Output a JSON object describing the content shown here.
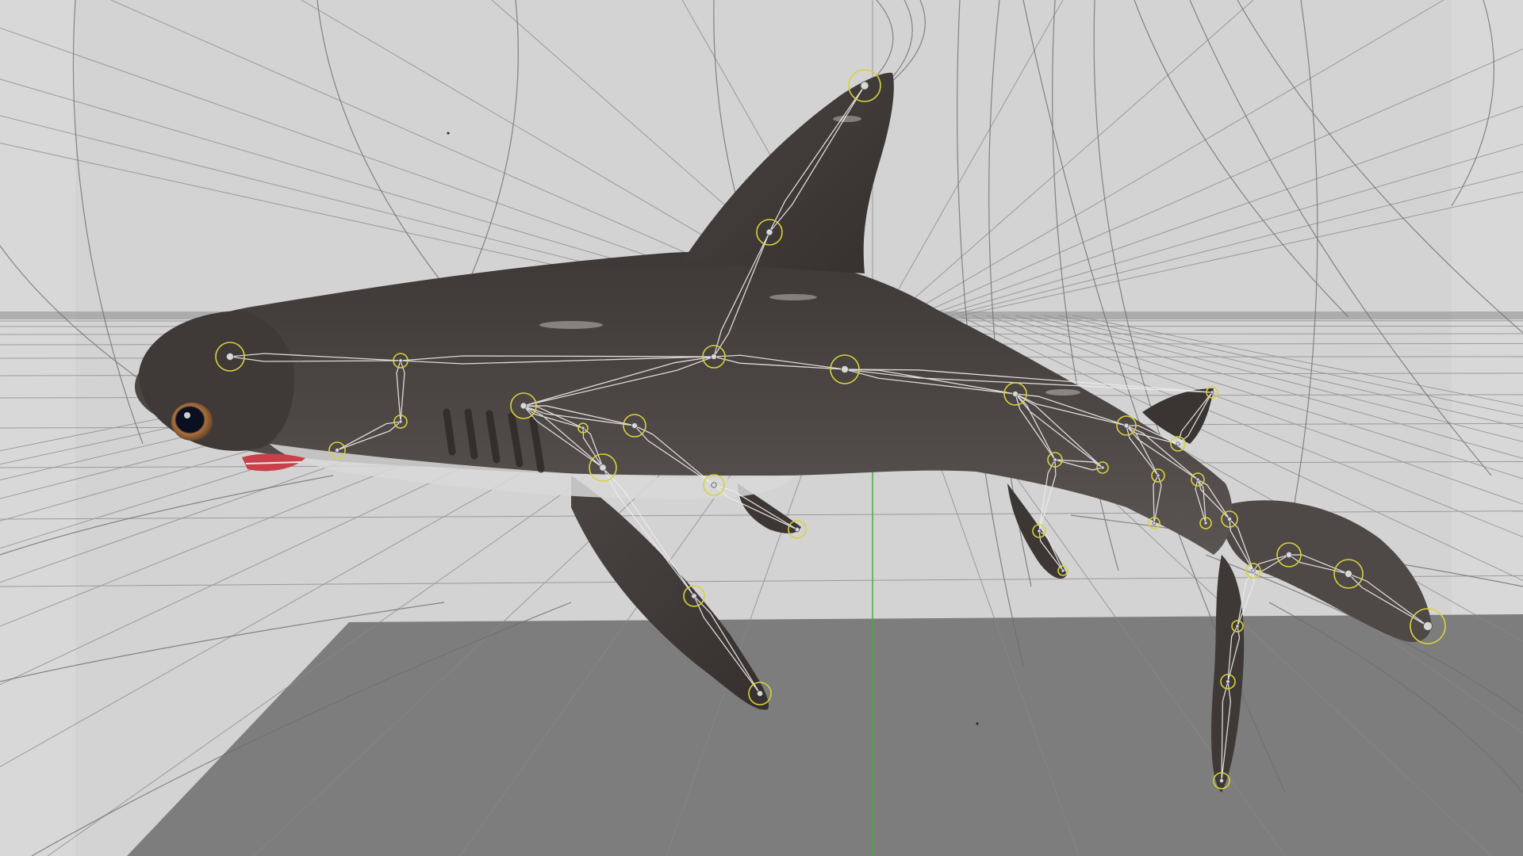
{
  "viewport": {
    "mode": "3d-perspective",
    "background_color": "#d3d3d3",
    "floor_color": "#7d7d7d",
    "grid_line_color": "#8a8a8a",
    "y_axis_color": "#3fb23f"
  },
  "model": {
    "subject": "hammerhead-shark",
    "skin_color": "#4a4442",
    "belly_color": "#dcdcdc",
    "eye_color": "#8a5a3a",
    "mouth_color": "#c8404a"
  },
  "rig": {
    "bone_color": "#ececec",
    "joint_ring_color": "#d8d23a",
    "joint_count": 36
  }
}
